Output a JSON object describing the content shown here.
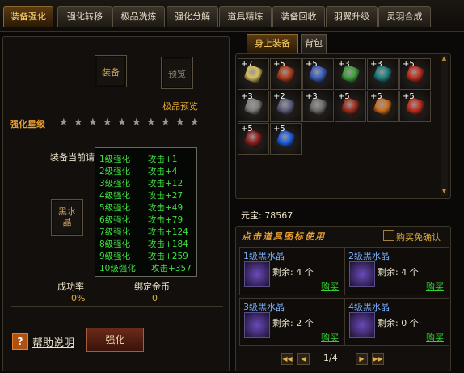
{
  "tabs": [
    "装备强化",
    "强化转移",
    "极品洗炼",
    "强化分解",
    "道具精炼",
    "装备回收",
    "羽翼升级",
    "灵羽合成"
  ],
  "left": {
    "equip_slot_label": "装备",
    "preview_slot_label": "预览",
    "preview_caption": "极品预览",
    "star_label": "强化星级",
    "current_label": "装备当前请",
    "black_crystal_label": "黑水晶",
    "success_rate_label": "成功率",
    "success_rate_value": "0%",
    "bound_gold_label": "绑定金币",
    "bound_gold_value": "0",
    "help_icon": "?",
    "help_label": "帮助说明",
    "enhance_button": "强化"
  },
  "popup": {
    "rows": [
      {
        "level": "1级强化",
        "attack": "攻击+1"
      },
      {
        "level": "2级强化",
        "attack": "攻击+4"
      },
      {
        "level": "3级强化",
        "attack": "攻击+12"
      },
      {
        "level": "4级强化",
        "attack": "攻击+27"
      },
      {
        "level": "5级强化",
        "attack": "攻击+49"
      },
      {
        "level": "6级强化",
        "attack": "攻击+79"
      },
      {
        "level": "7级强化",
        "attack": "攻击+124"
      },
      {
        "level": "8级强化",
        "attack": "攻击+184"
      },
      {
        "level": "9级强化",
        "attack": "攻击+259"
      },
      {
        "level": "10级强化",
        "attack": "攻击+357"
      }
    ]
  },
  "right": {
    "subtabs": [
      "身上装备",
      "背包"
    ],
    "equipment": [
      {
        "plus": "+7",
        "name": "necklace-icon",
        "color": "#d8c060"
      },
      {
        "plus": "+5",
        "name": "bracelet-icon",
        "color": "#b04020"
      },
      {
        "plus": "+5",
        "name": "medal-icon",
        "color": "#4060c0"
      },
      {
        "plus": "+3",
        "name": "ring-icon",
        "color": "#40a040"
      },
      {
        "plus": "+3",
        "name": "ring-icon",
        "color": "#208080"
      },
      {
        "plus": "+5",
        "name": "ring-icon",
        "color": "#c03020"
      },
      {
        "plus": "+3",
        "name": "helmet-icon",
        "color": "#808080"
      },
      {
        "plus": "+2",
        "name": "boots-icon",
        "color": "#606080"
      },
      {
        "plus": "+3",
        "name": "armor-icon",
        "color": "#707070"
      },
      {
        "plus": "+5",
        "name": "weapon-icon",
        "color": "#a03020"
      },
      {
        "plus": "+5",
        "name": "gem-icon",
        "color": "#d07020"
      },
      {
        "plus": "+5",
        "name": "wings-icon",
        "color": "#c03020"
      },
      {
        "plus": "+5",
        "name": "shield-icon",
        "color": "#902020"
      },
      {
        "plus": "+5",
        "name": "crystal-icon",
        "color": "#2060e0"
      }
    ],
    "currency_label": "元宝:",
    "currency_value": "78567",
    "shop_hint": "点击道具图标使用",
    "buy_confirm_label": "购买免确认",
    "shop_items": [
      {
        "name": "1级黑水晶",
        "remaining": "剩余: 4 个",
        "buy": "购买"
      },
      {
        "name": "2级黑水晶",
        "remaining": "剩余: 4 个",
        "buy": "购买"
      },
      {
        "name": "3级黑水晶",
        "remaining": "剩余: 2 个",
        "buy": "购买"
      },
      {
        "name": "4级黑水晶",
        "remaining": "剩余: 0 个",
        "buy": "购买"
      }
    ],
    "page": "1/4"
  },
  "colors": {
    "accent": "#ffd36a",
    "green": "#3ee03e",
    "title_orange": "#e8a030"
  }
}
